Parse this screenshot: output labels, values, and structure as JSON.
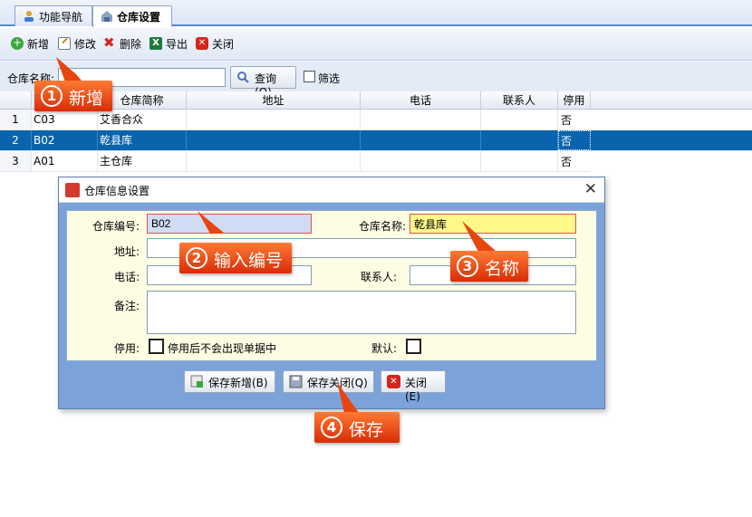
{
  "tabs": [
    {
      "label": "功能导航",
      "icon": "person-icon"
    },
    {
      "label": "仓库设置",
      "icon": "warehouse-icon"
    }
  ],
  "toolbar": {
    "new": "新增",
    "edit": "修改",
    "delete": "删除",
    "export": "导出",
    "close": "关闭"
  },
  "search": {
    "label": "仓库名称:",
    "value": "",
    "query_button": "查询(Q)",
    "filter_label": "筛选"
  },
  "grid": {
    "columns": [
      "仓库简称",
      "地址",
      "电话",
      "联系人",
      "停用"
    ],
    "rows": [
      {
        "n": "1",
        "code": "C03",
        "name": "艾香合众",
        "addr": "",
        "phone": "",
        "contact": "",
        "stop": "否"
      },
      {
        "n": "2",
        "code": "B02",
        "name": "乾县库",
        "addr": "",
        "phone": "",
        "contact": "",
        "stop": "否"
      },
      {
        "n": "3",
        "code": "A01",
        "name": "主仓库",
        "addr": "",
        "phone": "",
        "contact": "",
        "stop": "否"
      }
    ]
  },
  "dialog": {
    "title": "仓库信息设置",
    "code_label": "仓库编号:",
    "code_value": "B02",
    "name_label": "仓库名称:",
    "name_value": "乾县库",
    "addr_label": "地址:",
    "phone_label": "电话:",
    "contact_label": "联系人:",
    "remark_label": "备注:",
    "stop_label": "停用:",
    "stop_text": "停用后不会出现单据中",
    "default_label": "默认:",
    "save_new": "保存新增(B)",
    "save_close": "保存关闭(Q)",
    "close": "关闭(E)"
  },
  "callouts": [
    {
      "num": "1",
      "text": "新增"
    },
    {
      "num": "2",
      "text": "输入编号"
    },
    {
      "num": "3",
      "text": "名称"
    },
    {
      "num": "4",
      "text": "保存"
    }
  ],
  "colors": {
    "selection": "#0a64ad",
    "callout": "#e8450f",
    "dialog_bg": "#7ba3d9",
    "panel_bg": "#fdfde4"
  }
}
